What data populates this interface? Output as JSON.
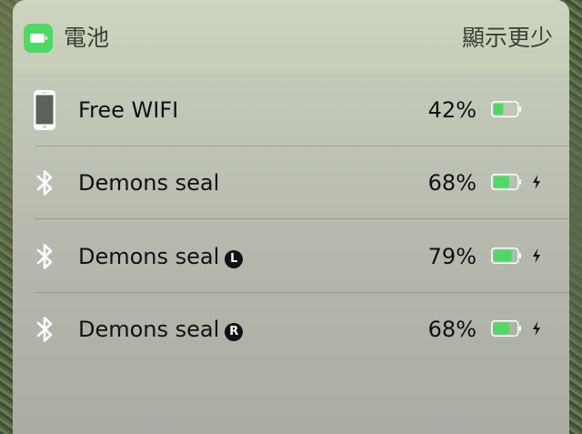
{
  "widget": {
    "title": "電池",
    "show_less": "顯示更少",
    "accent": "#4cd964"
  },
  "devices": [
    {
      "name": "Free WIFI",
      "badge": "",
      "percent_label": "42%",
      "level": 0.42,
      "icon": "iphone-icon",
      "charging": false
    },
    {
      "name": "Demons seal",
      "badge": "",
      "percent_label": "68%",
      "level": 0.68,
      "icon": "bluetooth-icon",
      "charging": true
    },
    {
      "name": "Demons seal",
      "badge": "L",
      "percent_label": "79%",
      "level": 0.79,
      "icon": "bluetooth-icon",
      "charging": true
    },
    {
      "name": "Demons seal",
      "badge": "R",
      "percent_label": "68%",
      "level": 0.68,
      "icon": "bluetooth-icon",
      "charging": true
    }
  ]
}
